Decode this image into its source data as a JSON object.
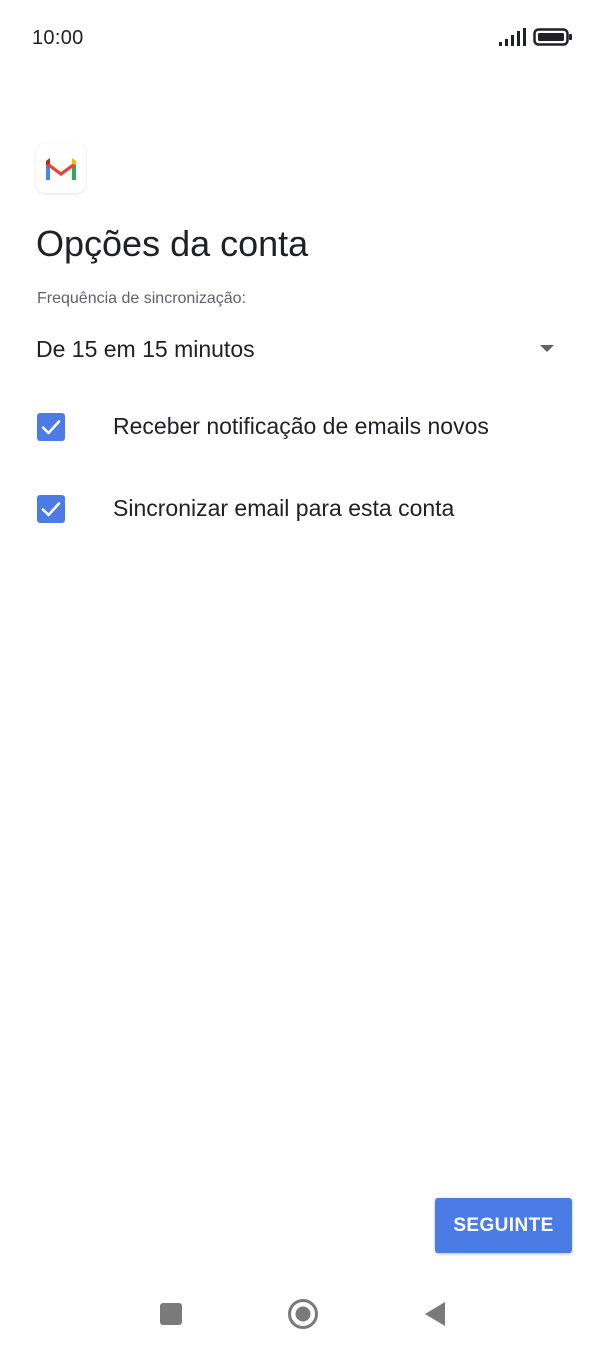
{
  "status_bar": {
    "time": "10:00",
    "signal_icon": "cell-signal-icon",
    "battery_icon": "battery-icon"
  },
  "app": {
    "logo_icon": "gmail-logo-icon"
  },
  "page": {
    "title": "Opções da conta"
  },
  "sync": {
    "label": "Frequência de sincronização:",
    "selected_value": "De 15 em 15 minutos"
  },
  "options": [
    {
      "label": "Receber notificação de emails novos",
      "checked": true
    },
    {
      "label": "Sincronizar email para esta conta",
      "checked": true
    }
  ],
  "actions": {
    "next_label": "SEGUINTE"
  },
  "nav": {
    "recents_icon": "square-recents-icon",
    "home_icon": "circle-home-icon",
    "back_icon": "triangle-back-icon"
  },
  "colors": {
    "accent": "#4b7be5",
    "text_primary": "#202124",
    "text_secondary": "#5f6368"
  }
}
